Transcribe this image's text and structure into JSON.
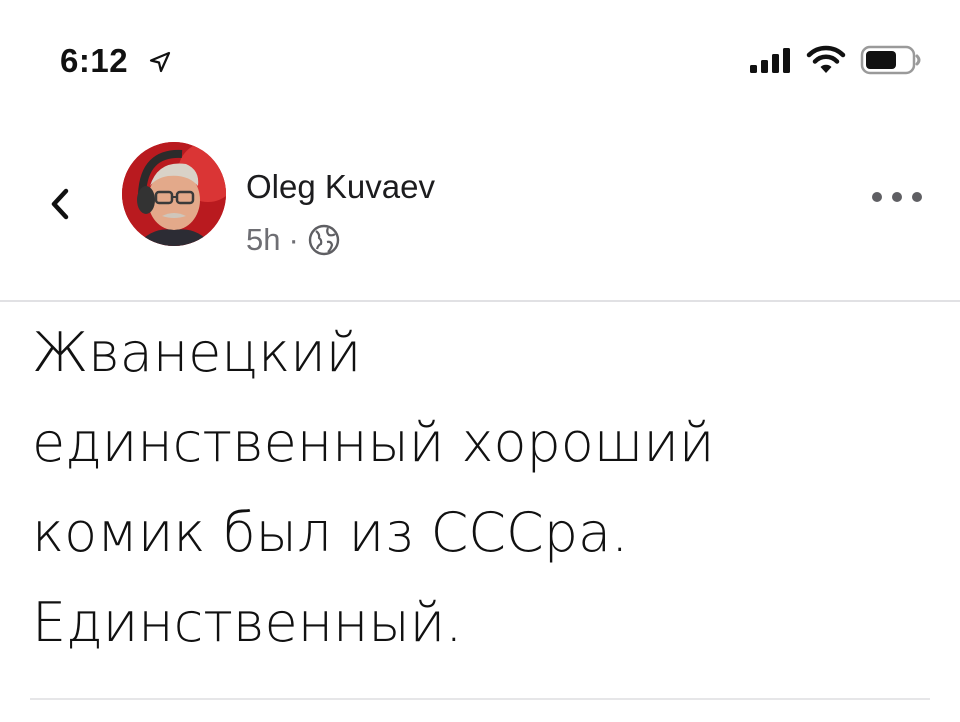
{
  "status_bar": {
    "time": "6:12",
    "icons": [
      "location-arrow-icon",
      "cellular-signal-icon",
      "wifi-icon",
      "battery-icon"
    ]
  },
  "header": {
    "back_icon": "chevron-left-icon",
    "author_name": "Oleg Kuvaev",
    "timestamp": "5h",
    "separator": "·",
    "audience_icon": "globe-icon",
    "more_icon": "more-horizontal-icon"
  },
  "post": {
    "lines": [
      "Жванецкий",
      "единственный хороший",
      "комик был из СССра.",
      "Единственный."
    ]
  },
  "colors": {
    "text_primary": "#111111",
    "text_secondary": "#6e6e73",
    "divider": "#e1e1e4",
    "avatar_accent": "#c0181e"
  }
}
